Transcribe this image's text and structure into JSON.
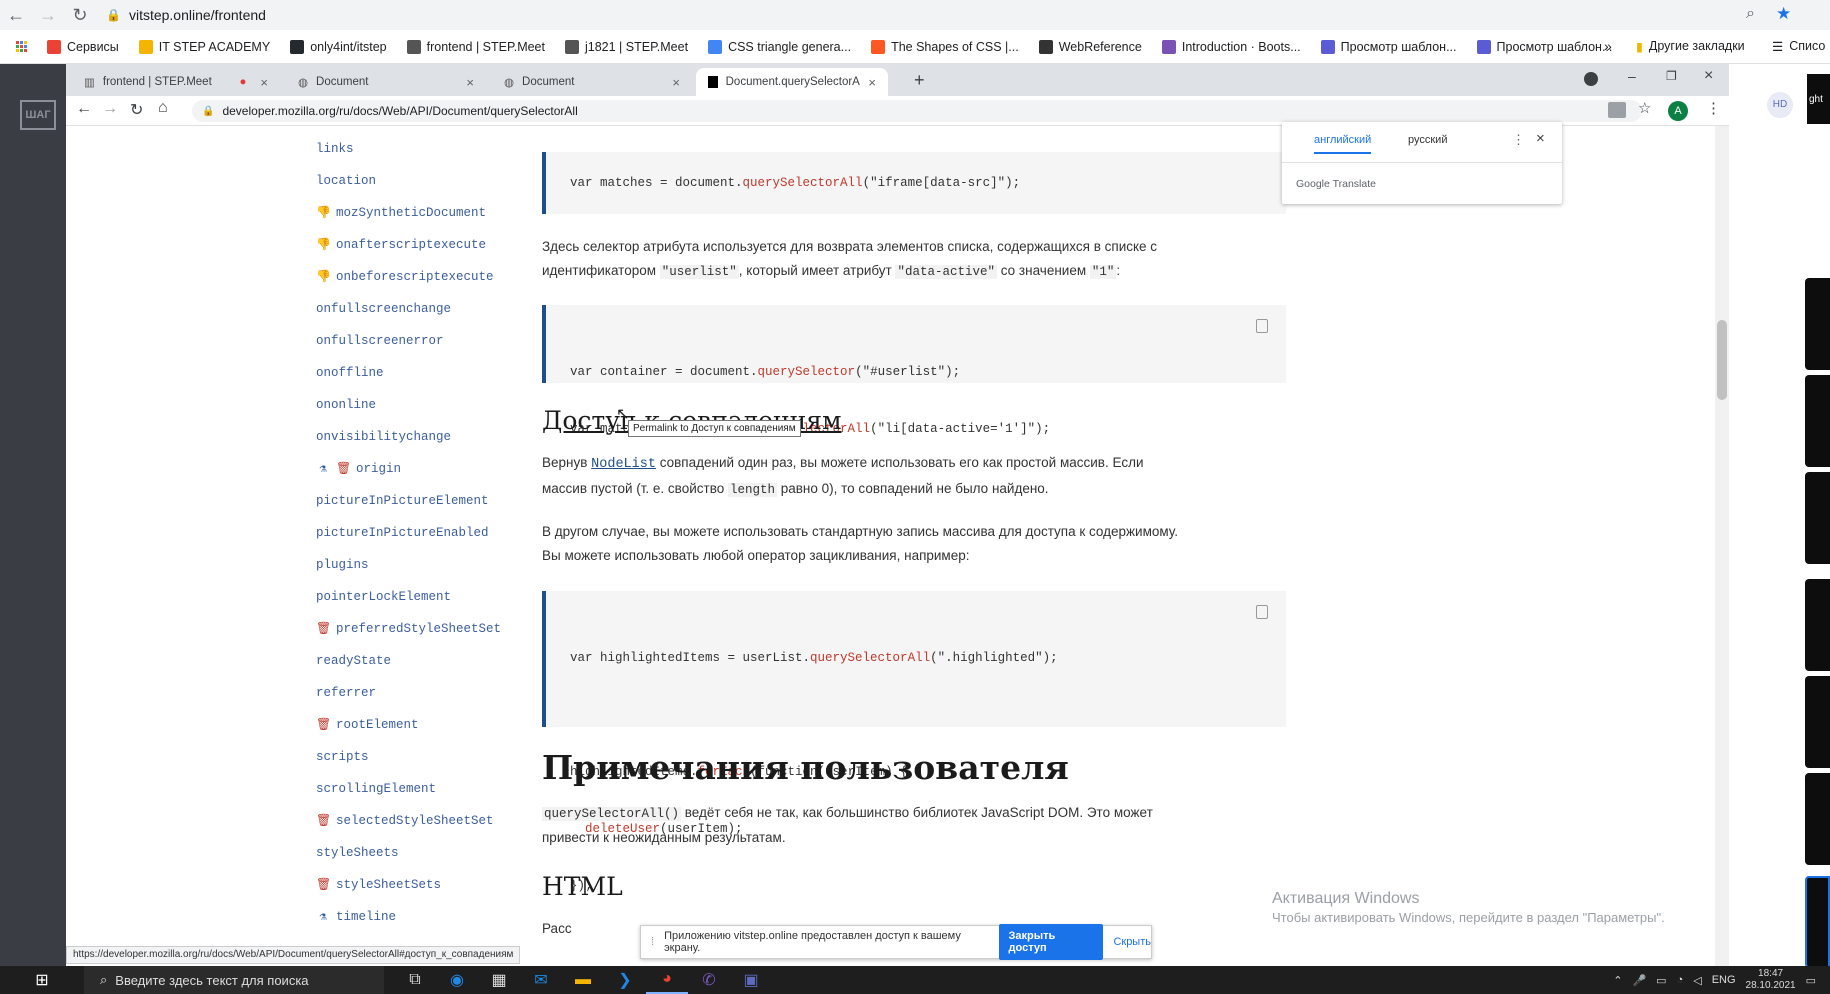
{
  "outer_browser": {
    "url": "vitstep.online/frontend",
    "bookmarks": [
      {
        "label": "Сервисы",
        "color": "#ea4335"
      },
      {
        "label": "IT STEP ACADEMY",
        "color": "#f4b400"
      },
      {
        "label": "only4int/itstep",
        "color": "#24292e"
      },
      {
        "label": "frontend | STEP.Meet",
        "color": "#555555"
      },
      {
        "label": "j1821 | STEP.Meet",
        "color": "#555555"
      },
      {
        "label": "CSS triangle genera...",
        "color": "#4285f4"
      },
      {
        "label": "The Shapes of CSS |...",
        "color": "#ff5722"
      },
      {
        "label": "WebReference",
        "color": "#333333"
      },
      {
        "label": "Introduction · Boots...",
        "color": "#7952b3"
      },
      {
        "label": "Просмотр шаблон...",
        "color": "#5b5bd6"
      },
      {
        "label": "Просмотр шаблон...",
        "color": "#5b5bd6"
      }
    ],
    "bookmarks_more": "»",
    "other_bookmarks": "Другие закладки",
    "reading_list": "Списо"
  },
  "inner_browser": {
    "tabs": [
      {
        "label": "frontend | STEP.Meet"
      },
      {
        "label": "Document"
      },
      {
        "label": "Document"
      },
      {
        "label": "Document.querySelectorAll() - W"
      }
    ],
    "url": "developer.mozilla.org/ru/docs/Web/API/Document/querySelectorAll",
    "avatar": "A",
    "status_url": "https://developer.mozilla.org/ru/docs/Web/API/Document/querySelectorAll#доступ_к_совпадениям"
  },
  "sidebar": {
    "items": [
      {
        "label": "links",
        "icon": ""
      },
      {
        "label": "location",
        "icon": ""
      },
      {
        "label": "mozSyntheticDocument",
        "icon": "thumbs-down"
      },
      {
        "label": "onafterscriptexecute",
        "icon": "thumbs-down"
      },
      {
        "label": "onbeforescriptexecute",
        "icon": "thumbs-down"
      },
      {
        "label": "onfullscreenchange",
        "icon": ""
      },
      {
        "label": "onfullscreenerror",
        "icon": ""
      },
      {
        "label": "onoffline",
        "icon": ""
      },
      {
        "label": "ononline",
        "icon": ""
      },
      {
        "label": "onvisibilitychange",
        "icon": ""
      },
      {
        "label": "origin",
        "icon": "flask-trash"
      },
      {
        "label": "pictureInPictureElement",
        "icon": ""
      },
      {
        "label": "pictureInPictureEnabled",
        "icon": ""
      },
      {
        "label": "plugins",
        "icon": ""
      },
      {
        "label": "pointerLockElement",
        "icon": ""
      },
      {
        "label": "preferredStyleSheetSet",
        "icon": "trash"
      },
      {
        "label": "readyState",
        "icon": ""
      },
      {
        "label": "referrer",
        "icon": ""
      },
      {
        "label": "rootElement",
        "icon": "trash"
      },
      {
        "label": "scripts",
        "icon": ""
      },
      {
        "label": "scrollingElement",
        "icon": ""
      },
      {
        "label": "selectedStyleSheetSet",
        "icon": "trash"
      },
      {
        "label": "styleSheets",
        "icon": ""
      },
      {
        "label": "styleSheetSets",
        "icon": "trash"
      },
      {
        "label": "timeline",
        "icon": "flask"
      }
    ]
  },
  "content": {
    "code1": {
      "pre": "var matches = document.",
      "fn": "querySelectorAll",
      "post": "(\"iframe[data-src]\");"
    },
    "para1_a": "Здесь селектор атрибута используется для возврата элементов списка, содержащихся в списке с",
    "para1_b_pre": "идентификатором ",
    "para1_b_code1": "\"userlist\"",
    "para1_b_mid": ", который имеет атрибут ",
    "para1_b_code2": "\"data-active\"",
    "para1_b_mid2": " со значением ",
    "para1_b_code3": "\"1\"",
    "para1_b_end": ":",
    "code2": {
      "l1_pre": "var container = document.",
      "l1_fn": "querySelector",
      "l1_post": "(\"#userlist\");",
      "l2_pre": "var matches = container.",
      "l2_fn": "querySelectorAll",
      "l2_post": "(\"li[data-active='1']\");"
    },
    "h_access": "Доступ к совпадениям",
    "tooltip": "Permalink to Доступ к совпадениям",
    "para2_a_pre": "Вернув ",
    "para2_a_link": "NodeList",
    "para2_a_post": " совпадений один раз, вы можете использовать его как простой массив. Если",
    "para2_b_pre": "массив пустой (т. е. свойство ",
    "para2_b_code": "length",
    "para2_b_post": " равно 0), то совпадений не было найдено.",
    "para3_a": "В другом случае, вы можете использовать стандартную запись массива для доступа к содержимому.",
    "para3_b": "Вы можете использовать любой оператор зацикливания, например:",
    "code3": {
      "l1_pre": "var highlightedItems = userList.",
      "l1_fn": "querySelectorAll",
      "l1_post": "(\".highlighted\");",
      "l2_pre": "highlightedItems.",
      "l2_fn": "forEach",
      "l2_post": "(function(userItem) {",
      "l3_fn": "  deleteUser",
      "l3_post": "(userItem);",
      "l4": "});"
    },
    "h_notes": "Примечания пользователя",
    "para4_code": "querySelectorAll()",
    "para4_a": " ведёт себя не так, как большинство библиотек JavaScript DOM. Это может",
    "para4_b": "привести к неожиданным результатам.",
    "h_html": "HTML",
    "para5": "Расс"
  },
  "translate": {
    "tab_en": "английский",
    "tab_ru": "русский",
    "brand": "Google Translate"
  },
  "share_bar": {
    "text": "Приложению vitstep.online предоставлен доступ к вашему экрану.",
    "stop_button": "Закрыть доступ",
    "hide": "Скрыть"
  },
  "watermark": {
    "title": "Активация Windows",
    "subtitle": "Чтобы активировать Windows, перейдите в раздел \"Параметры\"."
  },
  "taskbar": {
    "search_placeholder": "Введите здесь текст для поиска",
    "lang": "ENG",
    "time": "18:47",
    "date": "28.10.2021"
  },
  "right_panel": {
    "badge": "HD",
    "partial": "ght"
  }
}
